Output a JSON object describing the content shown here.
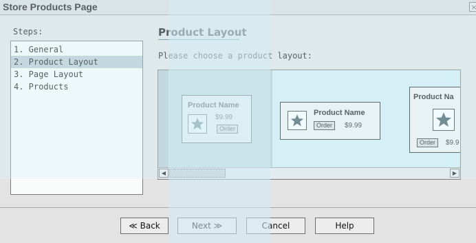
{
  "window": {
    "title": "Store Products Page",
    "close_glyph": "×"
  },
  "steps": {
    "label": "Steps:",
    "items": [
      {
        "label": "1. General"
      },
      {
        "label": "2. Product Layout",
        "selected": true
      },
      {
        "label": "3. Page Layout"
      },
      {
        "label": "4. Products"
      }
    ]
  },
  "main": {
    "title": "Product Layout",
    "prompt": "Please choose a product layout:",
    "layouts": [
      {
        "name": "Product Name",
        "price": "$9.99",
        "order_label": "Order",
        "selected": true
      },
      {
        "name": "Product Name",
        "price": "$9.99",
        "order_label": "Order"
      },
      {
        "name": "Product Na",
        "price": "$9.9",
        "order_label": "Order"
      }
    ],
    "scroll": {
      "left_arrow": "◀",
      "right_arrow": "▶"
    }
  },
  "buttons": {
    "back": "≪ Back",
    "next": "Next ≫",
    "cancel": "Cancel",
    "help": "Help"
  },
  "colors": {
    "accent": "#b9cdd3",
    "panel": "#d3eef5",
    "star": "#3d5860"
  },
  "icons": {
    "star": "star-icon",
    "close": "close-icon"
  }
}
